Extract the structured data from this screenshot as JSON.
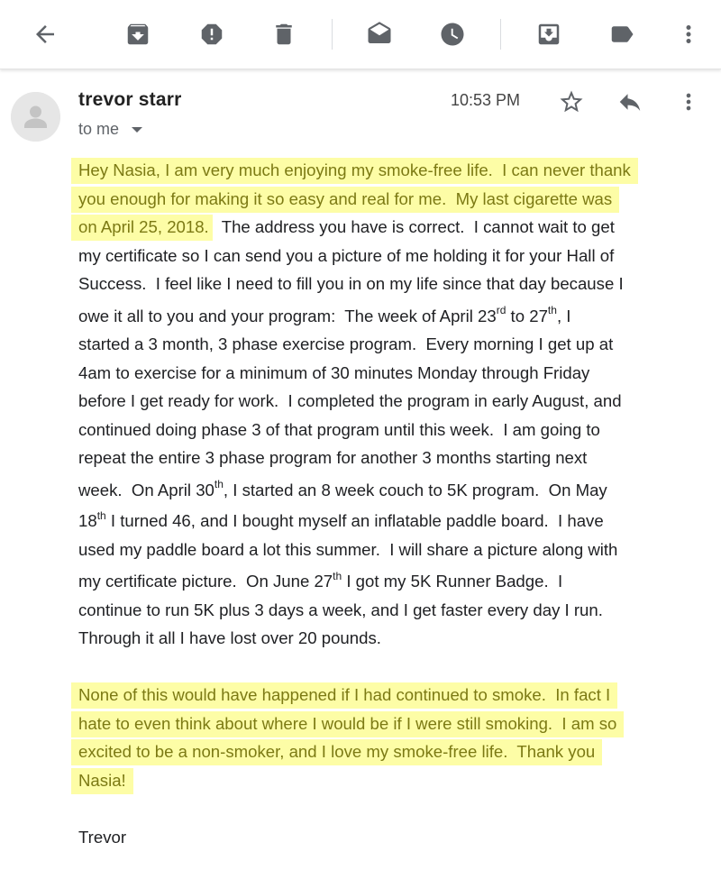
{
  "toolbar": {
    "buttons": [
      {
        "name": "back",
        "icon": "arrow-left-icon"
      },
      {
        "name": "archive",
        "icon": "archive-icon"
      },
      {
        "name": "report-spam",
        "icon": "report-spam-icon"
      },
      {
        "name": "delete",
        "icon": "trash-icon"
      },
      {
        "name": "mark-unread",
        "icon": "mark-unread-icon"
      },
      {
        "name": "snooze",
        "icon": "clock-icon"
      },
      {
        "name": "move-to",
        "icon": "move-to-inbox-icon"
      },
      {
        "name": "label",
        "icon": "label-icon"
      },
      {
        "name": "more",
        "icon": "more-vertical-icon"
      }
    ]
  },
  "email": {
    "sender": "trevor starr",
    "recipient": "to me",
    "time": "10:53 PM",
    "lines": {
      "l1": "Hey Nasia, I am very much enjoying my smoke-free life.  I can never thank",
      "l2": "you enough for making it so easy and real for me.  My last cigarette was",
      "l3a": "on April 25, 2018.",
      "l3b": "  The address you have is correct.  I cannot wait to get",
      "l4": "my certificate so I can send you a picture of me holding it for your Hall of",
      "l5": "Success.  I feel like I need to fill you in on my life since that day because I",
      "l6a": "owe it all to you and your program:  The week of April 23",
      "l6sup1": "rd",
      "l6b": " to 27",
      "l6sup2": "th",
      "l6c": ", I",
      "l7": "started a 3 month, 3 phase exercise program.  Every morning I get up at",
      "l8": "4am to exercise for a minimum of 30 minutes Monday through Friday",
      "l9": "before I get ready for work.  I completed the program in early August, and",
      "l10": "continued doing phase 3 of that program until this week.  I am going to",
      "l11": "repeat the entire 3 phase program for another 3 months starting next",
      "l12a": "week.  On April 30",
      "l12sup": "th",
      "l12b": ", I started an 8 week couch to 5K program.  On May",
      "l13a": "18",
      "l13sup": "th",
      "l13b": " I turned 46, and I bought myself an inflatable paddle board.  I have",
      "l14": "used my paddle board a lot this summer.  I will share a picture along with",
      "l15a": "my certificate picture.  On June 27",
      "l15sup": "th",
      "l15b": " I got my 5K Runner Badge.  I",
      "l16": "continue to run 5K plus 3 days a week, and I get faster every day I run.",
      "l17": "Through it all I have lost over 20 pounds.",
      "p2l1": "None of this would have happened if I had continued to smoke.  In fact I",
      "p2l2": "hate to even think about where I would be if I were still smoking.  I am so",
      "p2l3": "excited to be a non-smoker, and I love my smoke-free life.  Thank you",
      "p2l4": "Nasia!",
      "signature": "Trevor"
    }
  },
  "colors": {
    "highlight": "#fdfda6",
    "highlight_text": "#7c7a14",
    "icon": "#5f6368"
  }
}
